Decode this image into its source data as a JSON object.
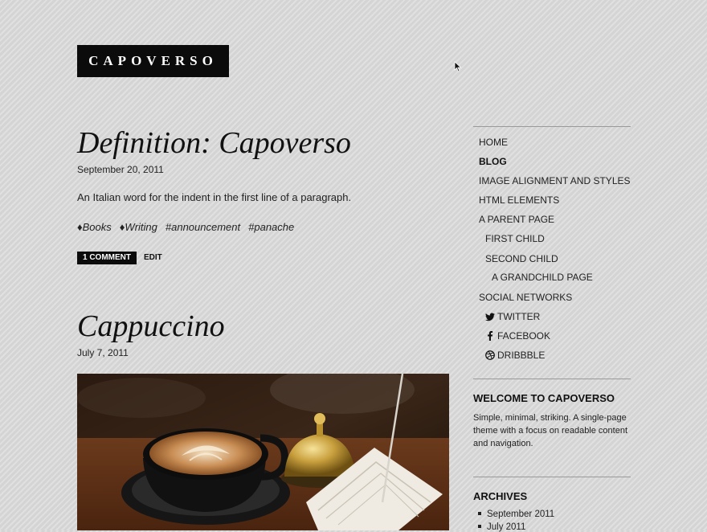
{
  "site": {
    "logo": "CAPOVERSO"
  },
  "posts": [
    {
      "title": "Definition: Capoverso",
      "date": "September 20, 2011",
      "excerpt": "An Italian word for the indent in the first line of a paragraph.",
      "categories": [
        "Books",
        "Writing"
      ],
      "tags": [
        "#announcement",
        "#panache"
      ],
      "comments_label": "1 COMMENT",
      "edit_label": "EDIT"
    },
    {
      "title": "Cappuccino",
      "date": "July 7, 2011"
    }
  ],
  "nav": {
    "items": [
      {
        "label": "HOME",
        "active": false
      },
      {
        "label": "BLOG",
        "active": true
      },
      {
        "label": "IMAGE ALIGNMENT AND STYLES",
        "active": false
      },
      {
        "label": "HTML ELEMENTS",
        "active": false
      },
      {
        "label": "A PARENT PAGE",
        "active": false
      },
      {
        "label": "FIRST CHILD",
        "active": false
      },
      {
        "label": "SECOND CHILD",
        "active": false
      },
      {
        "label": "A GRANDCHILD PAGE",
        "active": false
      },
      {
        "label": "SOCIAL NETWORKS",
        "active": false
      },
      {
        "label": "TWITTER",
        "icon": "twitter-icon"
      },
      {
        "label": "FACEBOOK",
        "icon": "facebook-icon"
      },
      {
        "label": "DRIBBBLE",
        "icon": "dribbble-icon"
      }
    ]
  },
  "widgets": {
    "welcome": {
      "title": "WELCOME TO CAPOVERSO",
      "text": "Simple, minimal, striking. A single-page theme with a focus on readable content and navigation."
    },
    "archives": {
      "title": "ARCHIVES",
      "items": [
        "September 2011",
        "July 2011"
      ]
    }
  }
}
